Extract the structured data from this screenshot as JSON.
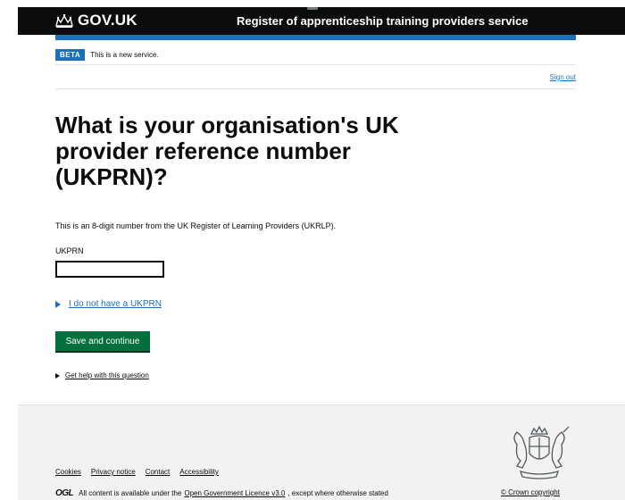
{
  "header": {
    "logo_text": "GOV.UK",
    "service_name": "Register of apprenticeship training providers service"
  },
  "phase_banner": {
    "tag": "BETA",
    "text": "This is a new service."
  },
  "nav": {
    "sign_out": "Sign out"
  },
  "main": {
    "heading": "What is your organisation's UK provider reference number (UKPRN)?",
    "hint": "This is an 8-digit number from the UK Register of Learning Providers (UKRLP).",
    "field_label": "UKPRN",
    "field_value": "",
    "details_summary": "I do not have a UKPRN",
    "submit_label": "Save and continue",
    "help_link": "Get help with this question"
  },
  "footer": {
    "links": [
      "Cookies",
      "Privacy notice",
      "Contact",
      "Accessibility"
    ],
    "ogl_logo": "OGL",
    "licence_prefix": "All content is available under the",
    "licence_link": "Open Government Licence v3.0",
    "licence_suffix": ", except where otherwise stated",
    "copyright": "© Crown copyright"
  },
  "colors": {
    "header_bg": "#0b0c0c",
    "brand_blue": "#1d70b8",
    "button_green": "#00703c",
    "footer_bg": "#f3f2f1"
  },
  "icons": [
    "crown-icon",
    "triangle-icon",
    "royal-crest-icon"
  ]
}
